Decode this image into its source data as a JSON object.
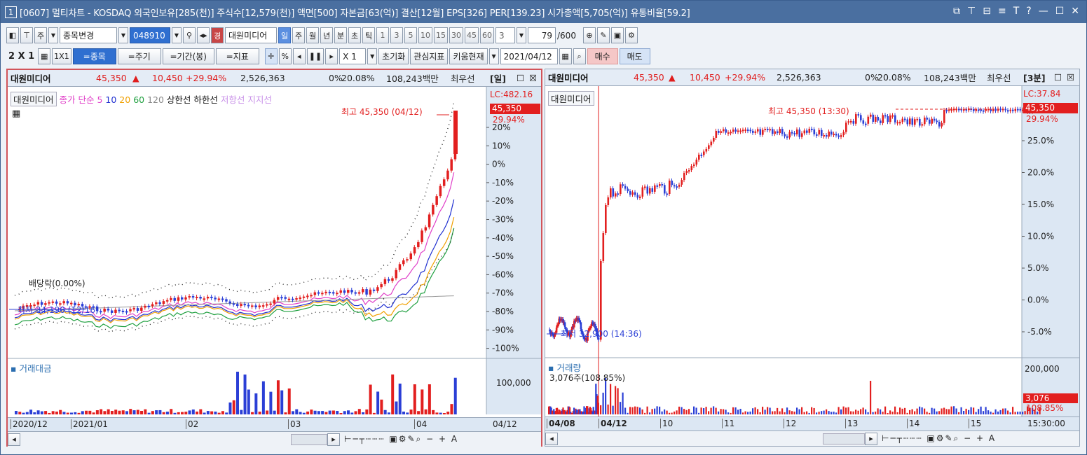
{
  "window": {
    "num": "1",
    "title": "[0607] 멀티차트 - KOSDAQ 외국인보유[285(천)] 주식수[12,579(천)] 액면[500] 자본금[63(억)] 결산[12월] EPS[326] PER[139.23] 시가총액[5,705(억)] 유통비율[59.2]",
    "controls": [
      "⧉",
      "⊤",
      "⊟",
      "≡",
      "T",
      "?",
      "—",
      "☐",
      "✕"
    ]
  },
  "toolbar1": {
    "market": "주",
    "stock_change": "종목변경",
    "code": "048910",
    "stock_tag": "경",
    "stock_name": "대원미디어",
    "periods": [
      "일",
      "주",
      "월",
      "년",
      "분",
      "초",
      "틱"
    ],
    "numbers": [
      "1",
      "3",
      "5",
      "10",
      "15",
      "30",
      "45",
      "60"
    ],
    "count": "3",
    "page": "79",
    "page_total": "/600"
  },
  "toolbar2": {
    "layout": "2 X 1",
    "one_by_one": "1X1",
    "b_stock": "=종목",
    "b_period": "=주기",
    "b_range": "=기간(봉)",
    "b_indicator": "=지표",
    "pct": "%",
    "scale": "X 1",
    "reset": "초기화",
    "interest": "관심지표",
    "kiwoom": "키움현재",
    "date": "2021/04/12",
    "buy": "매수",
    "sell": "매도"
  },
  "left": {
    "info": {
      "name": "대원미디어",
      "price": "45,350",
      "change": "10,450",
      "rate": "+29.94%",
      "volume": "2,526,363",
      "pct": "0%",
      "ratio": "20.08%",
      "amount": "108,243백만",
      "best": "최우선",
      "period": "[일]"
    },
    "legend": {
      "tag": "대원미디어",
      "close": "종가 단순",
      "ma": [
        "5",
        "10",
        "20",
        "60",
        "120"
      ],
      "upper": "상한선",
      "lower": "하한선",
      "resist": "저항선",
      "support": "지지선"
    },
    "lc": "LC:482.16",
    "cur_price": "45,350",
    "cur_rate": "29.94%",
    "y_ticks": [
      "20%",
      "10%",
      "0%",
      "-10%",
      "-20%",
      "-30%",
      "-40%",
      "-50%",
      "-60%",
      "-70%",
      "-80%",
      "-90%",
      "-100%"
    ],
    "high_label": "최고 45,350 (04/12)",
    "low_label": "최저 34,190 (12/16)",
    "dividend": "배당락(0.00%)",
    "vol_title": "거래대금",
    "vol_tick": "100,000",
    "x_ticks": [
      "2020/12",
      "2021/01",
      "02",
      "03",
      "04"
    ],
    "x_right": "04/12"
  },
  "right": {
    "info": {
      "name": "대원미디어",
      "price": "45,350",
      "change": "10,450",
      "rate": "+29.94%",
      "volume": "2,526,363",
      "pct": "0%",
      "ratio": "20.08%",
      "amount": "108,243백만",
      "best": "최우선",
      "period": "[3분]"
    },
    "legend": {
      "tag": "대원미디어"
    },
    "lc": "LC:37.84",
    "cur_price": "45,350",
    "cur_rate": "29.94%",
    "y_ticks": [
      "25.0%",
      "20.0%",
      "15.0%",
      "10.0%",
      "5.0%",
      "0.0%",
      "-5.0%"
    ],
    "high_label": "최고 45,350 (13:30)",
    "low_label": "최저 32,900 (14:36)",
    "vol_title": "거래량",
    "vol_sub": "3,076주(108.85%)",
    "vol_tick": "200,000",
    "vol_cur": "3,076",
    "vol_rate": "108.85%",
    "x_ticks": [
      "04/08",
      "04/12",
      "10",
      "11",
      "12",
      "13",
      "14",
      "15"
    ],
    "x_right": "15:30:00"
  },
  "colors": {
    "up": "#e21f1f",
    "down": "#2b3fd6",
    "ma5": "#e040c8",
    "ma10": "#2030d0",
    "ma20": "#f0a000",
    "ma60": "#20a040",
    "ma120": "#888888"
  }
}
